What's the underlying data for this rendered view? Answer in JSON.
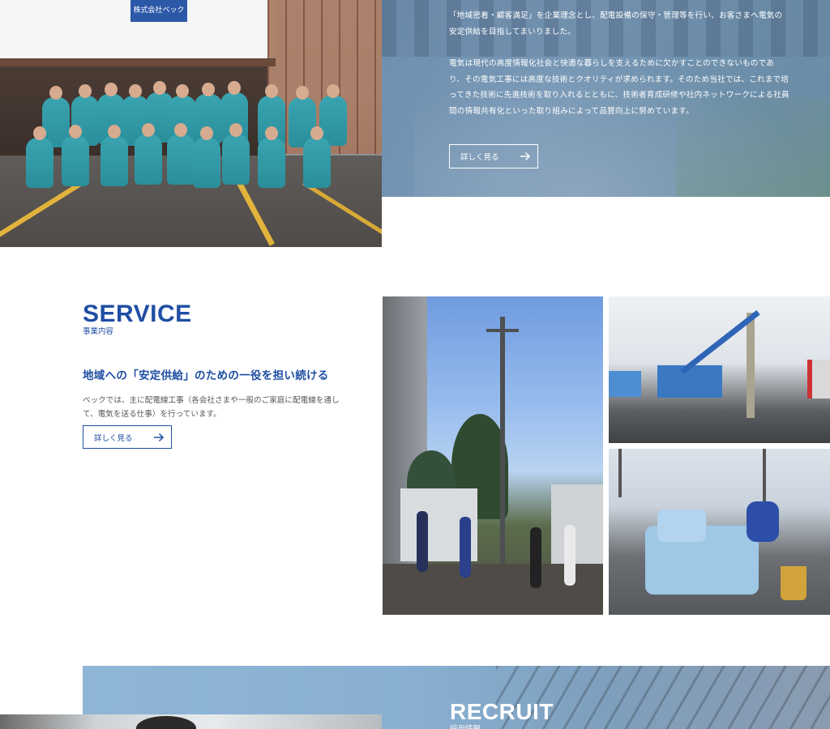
{
  "about": {
    "sign_text": "株式会社ベック",
    "paragraph1": "「地域密着・顧客満足」を企業理念とし、配電設備の保守・管理等を行い、お客さまへ電気の安定供給を目指してまいりました。",
    "paragraph2": "電気は現代の高度情報化社会と快適な暮らしを支えるために欠かすことのできないものであり、その電気工事には高度な技術とクオリティが求められます。そのため当社では、これまで培ってきた技術に先進技術を取り入れるとともに、技術者育成研修や社内ネットワークによる社員間の情報共有化といった取り組みによって品質向上に努めています。",
    "button_label": "詳しく見る"
  },
  "service": {
    "title": "SERVICE",
    "subtitle": "事業内容",
    "heading": "地域への「安定供給」のための一役を担い続ける",
    "description": "ベックでは、主に配電線工事（各会社さまや一般のご家庭に配電線を通して、電気を送る仕事）を行っています。",
    "button_label": "詳しく見る"
  },
  "recruit": {
    "title": "RECRUIT",
    "subtitle": "採用情報"
  },
  "colors": {
    "brand_blue": "#1f4ea3",
    "panel_blue": "#7898b6",
    "white": "#ffffff"
  }
}
